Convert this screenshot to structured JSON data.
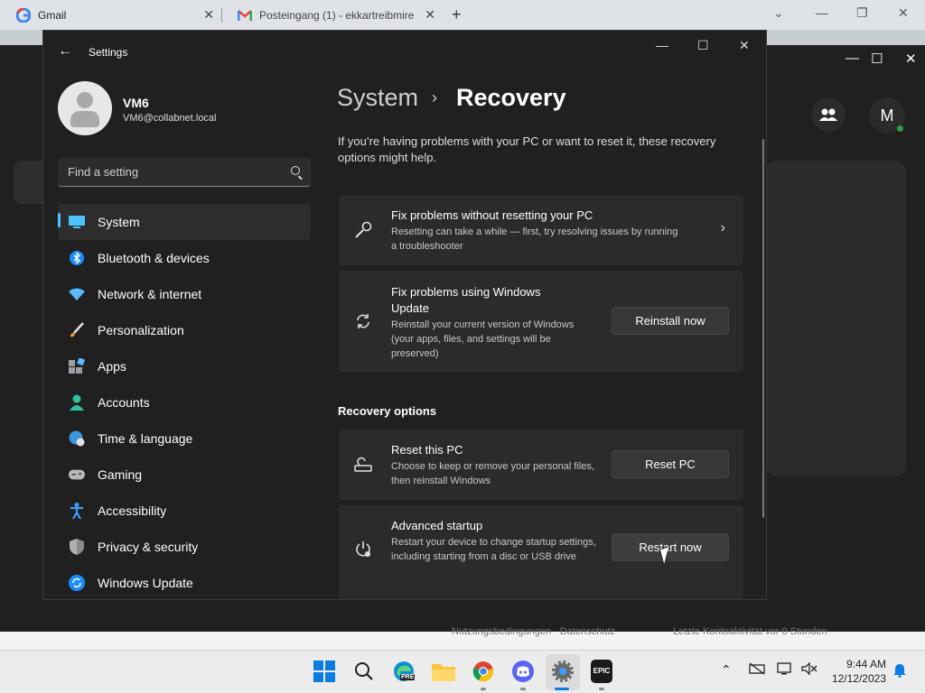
{
  "browser": {
    "tabs": [
      {
        "label": "Gmail",
        "favicon": "google-icon"
      },
      {
        "label": "Posteingang (1) - ekkartreibmire",
        "favicon": "gmail-icon"
      }
    ],
    "new_tab_symbol": "+"
  },
  "background_app": {
    "avatar_letter": "M",
    "footer_text_1": "Nutzungsbedingungen · Datenschutz",
    "footer_text_2": "Letzte Kontoaktivität vor 0 Stunden"
  },
  "settings": {
    "title": "Settings",
    "profile": {
      "name": "VM6",
      "email": "VM6@collabnet.local"
    },
    "search": {
      "placeholder": "Find a setting"
    },
    "nav": [
      {
        "label": "System",
        "icon": "system-icon",
        "active": true
      },
      {
        "label": "Bluetooth & devices",
        "icon": "bluetooth-icon"
      },
      {
        "label": "Network & internet",
        "icon": "wifi-icon"
      },
      {
        "label": "Personalization",
        "icon": "brush-icon"
      },
      {
        "label": "Apps",
        "icon": "apps-icon"
      },
      {
        "label": "Accounts",
        "icon": "accounts-icon"
      },
      {
        "label": "Time & language",
        "icon": "globe-clock-icon"
      },
      {
        "label": "Gaming",
        "icon": "gamepad-icon"
      },
      {
        "label": "Accessibility",
        "icon": "accessibility-icon"
      },
      {
        "label": "Privacy & security",
        "icon": "shield-icon"
      },
      {
        "label": "Windows Update",
        "icon": "update-icon"
      }
    ],
    "breadcrumb": {
      "parent": "System",
      "separator": "›",
      "current": "Recovery"
    },
    "intro": "If you’re having problems with your PC or want to reset it, these recovery options might help.",
    "cards": {
      "troubleshoot": {
        "title": "Fix problems without resetting your PC",
        "desc": "Resetting can take a while — first, try resolving issues by running a troubleshooter"
      },
      "windows_update": {
        "title": "Fix problems using Windows Update",
        "desc": "Reinstall your current version of Windows (your apps, files, and settings will be preserved)",
        "button": "Reinstall now"
      }
    },
    "recovery_options_header": "Recovery options",
    "recovery_cards": {
      "reset": {
        "title": "Reset this PC",
        "desc": "Choose to keep or remove your personal files, then reinstall Windows",
        "button": "Reset PC"
      },
      "advanced": {
        "title": "Advanced startup",
        "desc": "Restart your device to change startup settings, including starting from a disc or USB drive",
        "button": "Restart now"
      }
    }
  },
  "taskbar": {
    "time": "9:44 AM",
    "date": "12/12/2023",
    "epic_label": "EPIC",
    "edge_badge": "PRE"
  }
}
